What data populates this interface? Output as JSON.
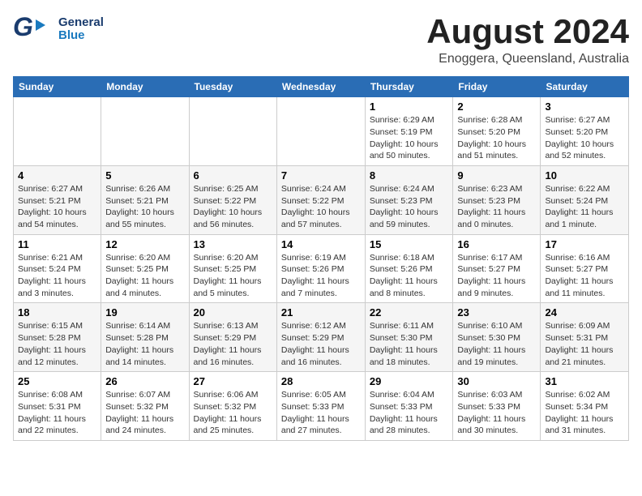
{
  "header": {
    "logo": {
      "general": "General",
      "blue": "Blue",
      "arrow": "▶"
    },
    "title": "August 2024",
    "subtitle": "Enoggera, Queensland, Australia"
  },
  "calendar": {
    "days_of_week": [
      "Sunday",
      "Monday",
      "Tuesday",
      "Wednesday",
      "Thursday",
      "Friday",
      "Saturday"
    ],
    "weeks": [
      [
        {
          "day": "",
          "text": ""
        },
        {
          "day": "",
          "text": ""
        },
        {
          "day": "",
          "text": ""
        },
        {
          "day": "",
          "text": ""
        },
        {
          "day": "1",
          "text": "Sunrise: 6:29 AM\nSunset: 5:19 PM\nDaylight: 10 hours and 50 minutes."
        },
        {
          "day": "2",
          "text": "Sunrise: 6:28 AM\nSunset: 5:20 PM\nDaylight: 10 hours and 51 minutes."
        },
        {
          "day": "3",
          "text": "Sunrise: 6:27 AM\nSunset: 5:20 PM\nDaylight: 10 hours and 52 minutes."
        }
      ],
      [
        {
          "day": "4",
          "text": "Sunrise: 6:27 AM\nSunset: 5:21 PM\nDaylight: 10 hours and 54 minutes."
        },
        {
          "day": "5",
          "text": "Sunrise: 6:26 AM\nSunset: 5:21 PM\nDaylight: 10 hours and 55 minutes."
        },
        {
          "day": "6",
          "text": "Sunrise: 6:25 AM\nSunset: 5:22 PM\nDaylight: 10 hours and 56 minutes."
        },
        {
          "day": "7",
          "text": "Sunrise: 6:24 AM\nSunset: 5:22 PM\nDaylight: 10 hours and 57 minutes."
        },
        {
          "day": "8",
          "text": "Sunrise: 6:24 AM\nSunset: 5:23 PM\nDaylight: 10 hours and 59 minutes."
        },
        {
          "day": "9",
          "text": "Sunrise: 6:23 AM\nSunset: 5:23 PM\nDaylight: 11 hours and 0 minutes."
        },
        {
          "day": "10",
          "text": "Sunrise: 6:22 AM\nSunset: 5:24 PM\nDaylight: 11 hours and 1 minute."
        }
      ],
      [
        {
          "day": "11",
          "text": "Sunrise: 6:21 AM\nSunset: 5:24 PM\nDaylight: 11 hours and 3 minutes."
        },
        {
          "day": "12",
          "text": "Sunrise: 6:20 AM\nSunset: 5:25 PM\nDaylight: 11 hours and 4 minutes."
        },
        {
          "day": "13",
          "text": "Sunrise: 6:20 AM\nSunset: 5:25 PM\nDaylight: 11 hours and 5 minutes."
        },
        {
          "day": "14",
          "text": "Sunrise: 6:19 AM\nSunset: 5:26 PM\nDaylight: 11 hours and 7 minutes."
        },
        {
          "day": "15",
          "text": "Sunrise: 6:18 AM\nSunset: 5:26 PM\nDaylight: 11 hours and 8 minutes."
        },
        {
          "day": "16",
          "text": "Sunrise: 6:17 AM\nSunset: 5:27 PM\nDaylight: 11 hours and 9 minutes."
        },
        {
          "day": "17",
          "text": "Sunrise: 6:16 AM\nSunset: 5:27 PM\nDaylight: 11 hours and 11 minutes."
        }
      ],
      [
        {
          "day": "18",
          "text": "Sunrise: 6:15 AM\nSunset: 5:28 PM\nDaylight: 11 hours and 12 minutes."
        },
        {
          "day": "19",
          "text": "Sunrise: 6:14 AM\nSunset: 5:28 PM\nDaylight: 11 hours and 14 minutes."
        },
        {
          "day": "20",
          "text": "Sunrise: 6:13 AM\nSunset: 5:29 PM\nDaylight: 11 hours and 16 minutes."
        },
        {
          "day": "21",
          "text": "Sunrise: 6:12 AM\nSunset: 5:29 PM\nDaylight: 11 hours and 16 minutes."
        },
        {
          "day": "22",
          "text": "Sunrise: 6:11 AM\nSunset: 5:30 PM\nDaylight: 11 hours and 18 minutes."
        },
        {
          "day": "23",
          "text": "Sunrise: 6:10 AM\nSunset: 5:30 PM\nDaylight: 11 hours and 19 minutes."
        },
        {
          "day": "24",
          "text": "Sunrise: 6:09 AM\nSunset: 5:31 PM\nDaylight: 11 hours and 21 minutes."
        }
      ],
      [
        {
          "day": "25",
          "text": "Sunrise: 6:08 AM\nSunset: 5:31 PM\nDaylight: 11 hours and 22 minutes."
        },
        {
          "day": "26",
          "text": "Sunrise: 6:07 AM\nSunset: 5:32 PM\nDaylight: 11 hours and 24 minutes."
        },
        {
          "day": "27",
          "text": "Sunrise: 6:06 AM\nSunset: 5:32 PM\nDaylight: 11 hours and 25 minutes."
        },
        {
          "day": "28",
          "text": "Sunrise: 6:05 AM\nSunset: 5:33 PM\nDaylight: 11 hours and 27 minutes."
        },
        {
          "day": "29",
          "text": "Sunrise: 6:04 AM\nSunset: 5:33 PM\nDaylight: 11 hours and 28 minutes."
        },
        {
          "day": "30",
          "text": "Sunrise: 6:03 AM\nSunset: 5:33 PM\nDaylight: 11 hours and 30 minutes."
        },
        {
          "day": "31",
          "text": "Sunrise: 6:02 AM\nSunset: 5:34 PM\nDaylight: 11 hours and 31 minutes."
        }
      ]
    ]
  }
}
